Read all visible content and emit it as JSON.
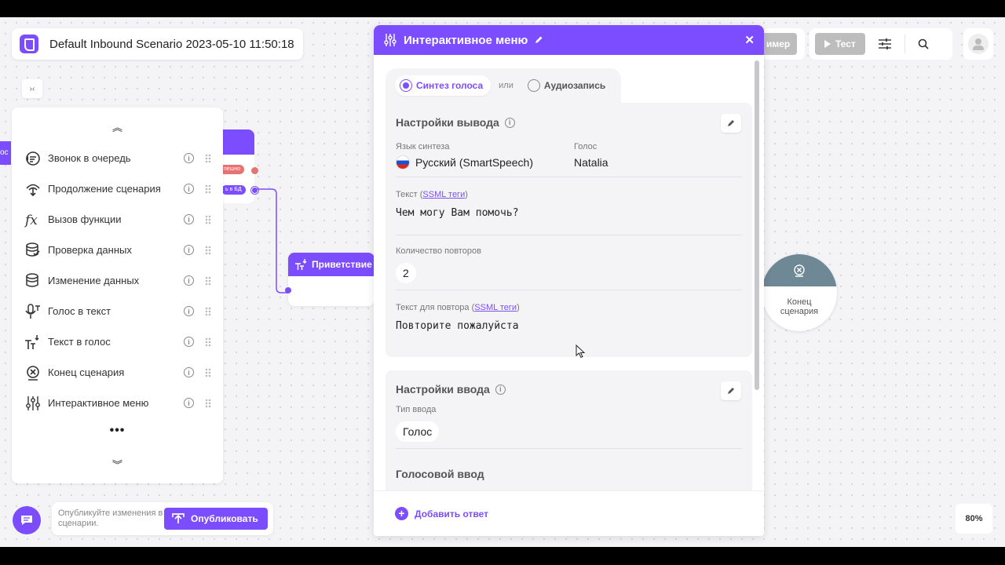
{
  "app": {
    "title": "Default Inbound Scenario 2023-05-10 11:50:18"
  },
  "toolbar": {
    "example_label": "имер",
    "test_label": "Тест"
  },
  "palette": {
    "items": [
      {
        "label": "Звонок в очередь",
        "icon": "queue-call-icon"
      },
      {
        "label": "Продолжение сценария",
        "icon": "continue-scenario-icon"
      },
      {
        "label": "Вызов функции",
        "icon": "function-icon"
      },
      {
        "label": "Проверка данных",
        "icon": "data-check-icon"
      },
      {
        "label": "Изменение данных",
        "icon": "data-edit-icon"
      },
      {
        "label": "Голос в текст",
        "icon": "speech-to-text-icon"
      },
      {
        "label": "Текст в голос",
        "icon": "text-to-speech-icon"
      },
      {
        "label": "Конец сценария",
        "icon": "end-scenario-icon"
      },
      {
        "label": "Интерактивное меню",
        "icon": "interactive-menu-icon"
      }
    ],
    "more": "•••"
  },
  "canvas": {
    "left_stub": "ос",
    "top_node": {
      "pill_success": "пешно",
      "pill_db": "ь в БД"
    },
    "greeting_node": {
      "title": "Приветствие"
    },
    "end_node": {
      "label_line1": "Конец",
      "label_line2": "сценария"
    }
  },
  "modal": {
    "title": "Интерактивное меню",
    "close": "✕",
    "mode": {
      "option1": "Синтез голоса",
      "or": "или",
      "option2": "Аудиозапись",
      "selected": "Синтез голоса"
    },
    "output": {
      "title": "Настройки вывода",
      "lang_label": "Язык синтеза",
      "lang_value": "Русский (SmartSpeech)",
      "voice_label": "Голос",
      "voice_value": "Natalia",
      "text_label": "Текст (",
      "text_link": "SSML теги",
      "text_label_end": ")",
      "text_value": "Чем могу Вам помочь?",
      "repeat_label": "Количество повторов",
      "repeat_value": "2",
      "repeat_text_label": "Текст для повтора (",
      "repeat_text_link": "SSML теги",
      "repeat_text_label_end": ")",
      "repeat_text_value": "Повторите пожалуйста"
    },
    "input": {
      "title": "Настройки ввода",
      "type_label": "Тип ввода",
      "type_value": "Голос",
      "voice_input_title": "Голосовой ввод"
    },
    "footer": {
      "add_answer": "Добавить ответ"
    }
  },
  "publish": {
    "hint": "Опубликуйте изменения в сценарии.",
    "button": "Опубликовать"
  },
  "zoom": "80%",
  "colors": {
    "accent": "#7c4dff",
    "end_node": "#6f8895"
  }
}
